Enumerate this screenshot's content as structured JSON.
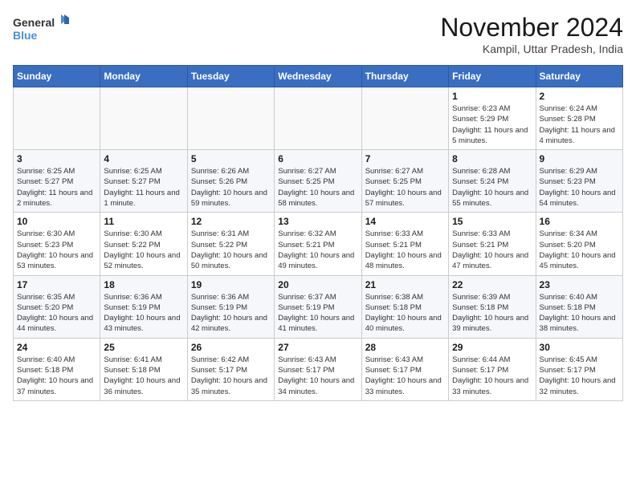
{
  "header": {
    "logo_general": "General",
    "logo_blue": "Blue",
    "month_title": "November 2024",
    "subtitle": "Kampil, Uttar Pradesh, India"
  },
  "days_of_week": [
    "Sunday",
    "Monday",
    "Tuesday",
    "Wednesday",
    "Thursday",
    "Friday",
    "Saturday"
  ],
  "weeks": [
    [
      {
        "day": "",
        "sunrise": "",
        "sunset": "",
        "daylight": ""
      },
      {
        "day": "",
        "sunrise": "",
        "sunset": "",
        "daylight": ""
      },
      {
        "day": "",
        "sunrise": "",
        "sunset": "",
        "daylight": ""
      },
      {
        "day": "",
        "sunrise": "",
        "sunset": "",
        "daylight": ""
      },
      {
        "day": "",
        "sunrise": "",
        "sunset": "",
        "daylight": ""
      },
      {
        "day": "1",
        "sunrise": "Sunrise: 6:23 AM",
        "sunset": "Sunset: 5:29 PM",
        "daylight": "Daylight: 11 hours and 5 minutes."
      },
      {
        "day": "2",
        "sunrise": "Sunrise: 6:24 AM",
        "sunset": "Sunset: 5:28 PM",
        "daylight": "Daylight: 11 hours and 4 minutes."
      }
    ],
    [
      {
        "day": "3",
        "sunrise": "Sunrise: 6:25 AM",
        "sunset": "Sunset: 5:27 PM",
        "daylight": "Daylight: 11 hours and 2 minutes."
      },
      {
        "day": "4",
        "sunrise": "Sunrise: 6:25 AM",
        "sunset": "Sunset: 5:27 PM",
        "daylight": "Daylight: 11 hours and 1 minute."
      },
      {
        "day": "5",
        "sunrise": "Sunrise: 6:26 AM",
        "sunset": "Sunset: 5:26 PM",
        "daylight": "Daylight: 10 hours and 59 minutes."
      },
      {
        "day": "6",
        "sunrise": "Sunrise: 6:27 AM",
        "sunset": "Sunset: 5:25 PM",
        "daylight": "Daylight: 10 hours and 58 minutes."
      },
      {
        "day": "7",
        "sunrise": "Sunrise: 6:27 AM",
        "sunset": "Sunset: 5:25 PM",
        "daylight": "Daylight: 10 hours and 57 minutes."
      },
      {
        "day": "8",
        "sunrise": "Sunrise: 6:28 AM",
        "sunset": "Sunset: 5:24 PM",
        "daylight": "Daylight: 10 hours and 55 minutes."
      },
      {
        "day": "9",
        "sunrise": "Sunrise: 6:29 AM",
        "sunset": "Sunset: 5:23 PM",
        "daylight": "Daylight: 10 hours and 54 minutes."
      }
    ],
    [
      {
        "day": "10",
        "sunrise": "Sunrise: 6:30 AM",
        "sunset": "Sunset: 5:23 PM",
        "daylight": "Daylight: 10 hours and 53 minutes."
      },
      {
        "day": "11",
        "sunrise": "Sunrise: 6:30 AM",
        "sunset": "Sunset: 5:22 PM",
        "daylight": "Daylight: 10 hours and 52 minutes."
      },
      {
        "day": "12",
        "sunrise": "Sunrise: 6:31 AM",
        "sunset": "Sunset: 5:22 PM",
        "daylight": "Daylight: 10 hours and 50 minutes."
      },
      {
        "day": "13",
        "sunrise": "Sunrise: 6:32 AM",
        "sunset": "Sunset: 5:21 PM",
        "daylight": "Daylight: 10 hours and 49 minutes."
      },
      {
        "day": "14",
        "sunrise": "Sunrise: 6:33 AM",
        "sunset": "Sunset: 5:21 PM",
        "daylight": "Daylight: 10 hours and 48 minutes."
      },
      {
        "day": "15",
        "sunrise": "Sunrise: 6:33 AM",
        "sunset": "Sunset: 5:21 PM",
        "daylight": "Daylight: 10 hours and 47 minutes."
      },
      {
        "day": "16",
        "sunrise": "Sunrise: 6:34 AM",
        "sunset": "Sunset: 5:20 PM",
        "daylight": "Daylight: 10 hours and 45 minutes."
      }
    ],
    [
      {
        "day": "17",
        "sunrise": "Sunrise: 6:35 AM",
        "sunset": "Sunset: 5:20 PM",
        "daylight": "Daylight: 10 hours and 44 minutes."
      },
      {
        "day": "18",
        "sunrise": "Sunrise: 6:36 AM",
        "sunset": "Sunset: 5:19 PM",
        "daylight": "Daylight: 10 hours and 43 minutes."
      },
      {
        "day": "19",
        "sunrise": "Sunrise: 6:36 AM",
        "sunset": "Sunset: 5:19 PM",
        "daylight": "Daylight: 10 hours and 42 minutes."
      },
      {
        "day": "20",
        "sunrise": "Sunrise: 6:37 AM",
        "sunset": "Sunset: 5:19 PM",
        "daylight": "Daylight: 10 hours and 41 minutes."
      },
      {
        "day": "21",
        "sunrise": "Sunrise: 6:38 AM",
        "sunset": "Sunset: 5:18 PM",
        "daylight": "Daylight: 10 hours and 40 minutes."
      },
      {
        "day": "22",
        "sunrise": "Sunrise: 6:39 AM",
        "sunset": "Sunset: 5:18 PM",
        "daylight": "Daylight: 10 hours and 39 minutes."
      },
      {
        "day": "23",
        "sunrise": "Sunrise: 6:40 AM",
        "sunset": "Sunset: 5:18 PM",
        "daylight": "Daylight: 10 hours and 38 minutes."
      }
    ],
    [
      {
        "day": "24",
        "sunrise": "Sunrise: 6:40 AM",
        "sunset": "Sunset: 5:18 PM",
        "daylight": "Daylight: 10 hours and 37 minutes."
      },
      {
        "day": "25",
        "sunrise": "Sunrise: 6:41 AM",
        "sunset": "Sunset: 5:18 PM",
        "daylight": "Daylight: 10 hours and 36 minutes."
      },
      {
        "day": "26",
        "sunrise": "Sunrise: 6:42 AM",
        "sunset": "Sunset: 5:17 PM",
        "daylight": "Daylight: 10 hours and 35 minutes."
      },
      {
        "day": "27",
        "sunrise": "Sunrise: 6:43 AM",
        "sunset": "Sunset: 5:17 PM",
        "daylight": "Daylight: 10 hours and 34 minutes."
      },
      {
        "day": "28",
        "sunrise": "Sunrise: 6:43 AM",
        "sunset": "Sunset: 5:17 PM",
        "daylight": "Daylight: 10 hours and 33 minutes."
      },
      {
        "day": "29",
        "sunrise": "Sunrise: 6:44 AM",
        "sunset": "Sunset: 5:17 PM",
        "daylight": "Daylight: 10 hours and 33 minutes."
      },
      {
        "day": "30",
        "sunrise": "Sunrise: 6:45 AM",
        "sunset": "Sunset: 5:17 PM",
        "daylight": "Daylight: 10 hours and 32 minutes."
      }
    ]
  ]
}
